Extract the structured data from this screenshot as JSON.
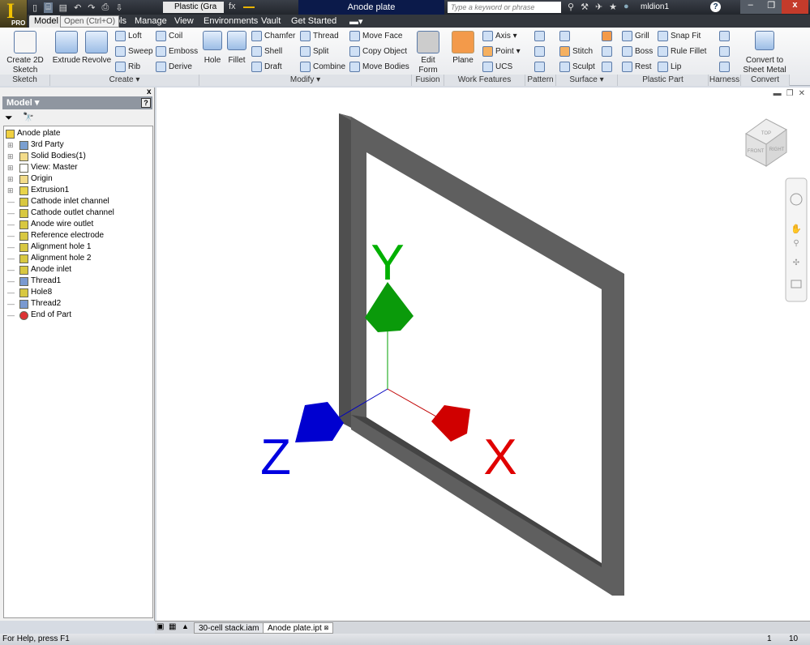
{
  "window": {
    "title": "Anode plate",
    "material": "Plastic (Gra",
    "search_placeholder": "Type a keyword or phrase",
    "user": "mldion1",
    "logo_text": "PRO",
    "tooltip": "Open (Ctrl+O)"
  },
  "ribbon_tabs": [
    {
      "label": "Model",
      "active": true
    },
    {
      "label": "ols"
    },
    {
      "label": "Manage"
    },
    {
      "label": "View"
    },
    {
      "label": "Environments"
    },
    {
      "label": "Vault"
    },
    {
      "label": "Get Started"
    }
  ],
  "panels": {
    "sketch": "Sketch",
    "create": "Create ▾",
    "modify": "Modify ▾",
    "fusion": "Fusion",
    "work": "Work Features",
    "pattern": "Pattern",
    "surface": "Surface ▾",
    "plastic": "Plastic Part",
    "harness": "Harness",
    "convert": "Convert"
  },
  "buttons": {
    "create_sketch": "Create 2D Sketch",
    "extrude": "Extrude",
    "revolve": "Revolve",
    "loft": "Loft",
    "sweep": "Sweep",
    "rib": "Rib",
    "coil": "Coil",
    "emboss": "Emboss",
    "derive": "Derive",
    "hole": "Hole",
    "fillet": "Fillet",
    "chamfer": "Chamfer",
    "shell": "Shell",
    "draft": "Draft",
    "thread": "Thread",
    "split": "Split",
    "combine": "Combine",
    "move_face": "Move Face",
    "copy_object": "Copy Object",
    "move_bodies": "Move Bodies",
    "edit_form": "Edit Form",
    "plane": "Plane",
    "axis": "Axis ▾",
    "point": "Point ▾",
    "ucs": "UCS",
    "stitch": "Stitch",
    "sculpt": "Sculpt",
    "grill": "Grill",
    "boss": "Boss",
    "rest": "Rest",
    "snap_fit": "Snap Fit",
    "rule_fillet": "Rule Fillet",
    "lip": "Lip",
    "convert_sheet_metal": "Convert to Sheet Metal"
  },
  "browser": {
    "title": "Model ▾",
    "help": "?",
    "tree": [
      {
        "label": "Anode plate",
        "level": 0,
        "icon": "part-icon"
      },
      {
        "label": "3rd Party",
        "level": 1,
        "expandable": true,
        "icon": "third-party-icon"
      },
      {
        "label": "Solid Bodies(1)",
        "level": 1,
        "expandable": true,
        "icon": "folder-icon"
      },
      {
        "label": "View: Master",
        "level": 1,
        "expandable": true,
        "icon": "view-icon"
      },
      {
        "label": "Origin",
        "level": 1,
        "expandable": true,
        "icon": "folder-icon"
      },
      {
        "label": "Extrusion1",
        "level": 1,
        "expandable": true,
        "icon": "extrusion-icon"
      },
      {
        "label": "Cathode inlet channel",
        "level": 1,
        "icon": "hole-icon"
      },
      {
        "label": "Cathode outlet channel",
        "level": 1,
        "icon": "hole-icon"
      },
      {
        "label": "Anode wire outlet",
        "level": 1,
        "icon": "hole-icon"
      },
      {
        "label": "Reference electrode",
        "level": 1,
        "icon": "hole-icon"
      },
      {
        "label": "Alignment hole 1",
        "level": 1,
        "icon": "hole-icon"
      },
      {
        "label": "Alignment hole 2",
        "level": 1,
        "icon": "hole-icon"
      },
      {
        "label": "Anode inlet",
        "level": 1,
        "icon": "hole-icon"
      },
      {
        "label": "Thread1",
        "level": 1,
        "icon": "thread-icon"
      },
      {
        "label": "Hole8",
        "level": 1,
        "icon": "hole-icon"
      },
      {
        "label": "Thread2",
        "level": 1,
        "icon": "thread-icon"
      },
      {
        "label": "End of Part",
        "level": 1,
        "icon": "end-of-part-icon"
      }
    ]
  },
  "viewport": {
    "axes": {
      "x": "X",
      "y": "Y",
      "z": "Z"
    },
    "colors": {
      "x": "#e00000",
      "y": "#00a000",
      "z": "#0000e0",
      "part": "#5f5f5f"
    },
    "viewcube": {
      "top": "TOP",
      "front": "FRONT",
      "right": "RIGHT"
    }
  },
  "doc_tabs": [
    {
      "label": "30-cell stack.iam"
    },
    {
      "label": "Anode plate.ipt",
      "active": true
    }
  ],
  "status": {
    "help": "For Help, press F1",
    "num1": "1",
    "num2": "10"
  }
}
